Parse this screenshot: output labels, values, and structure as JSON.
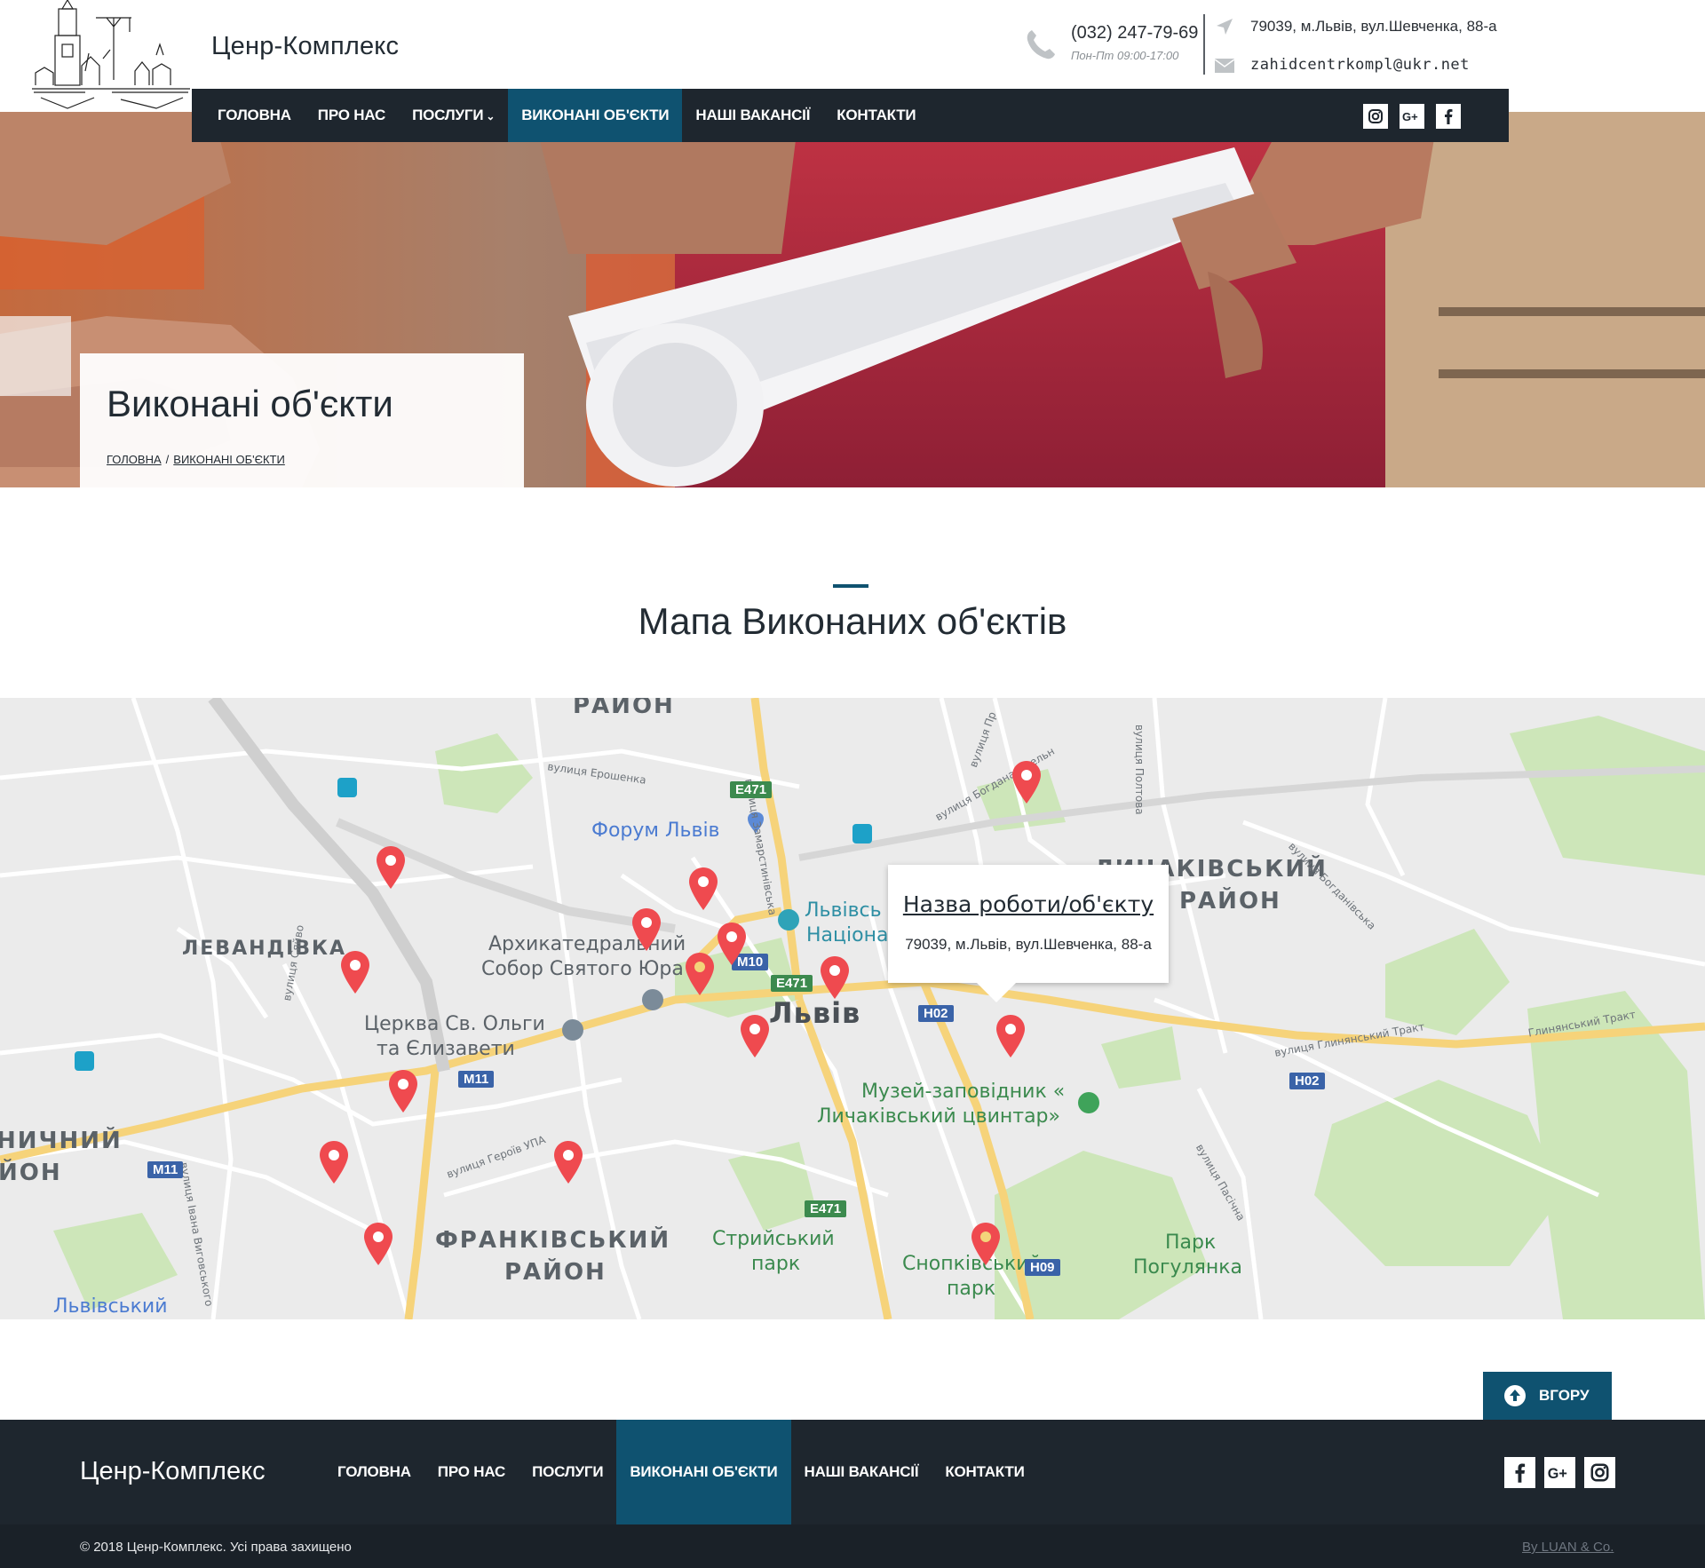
{
  "header": {
    "brand": "Ценр-Комплекс",
    "phone": "(032) 247-79-69",
    "hours": "Пон-Пт 09:00-17:00",
    "address": "79039, м.Львів, вул.Шевченка, 88-а",
    "email": "zahidcentrkompl@ukr.net"
  },
  "nav": {
    "items": [
      "ГОЛОВНА",
      "ПРО НАС",
      "ПОСЛУГИ",
      "ВИКОНАНІ ОБ'ЄКТИ",
      "НАШІ ВАКАНСІЇ",
      "КОНТАКТИ"
    ],
    "active": "ВИКОНАНІ ОБ'ЄКТИ",
    "social_icons": [
      "instagram-icon",
      "google-plus-icon",
      "facebook-icon"
    ]
  },
  "hero": {
    "title": "Виконані об'єкти",
    "breadcrumbs": [
      "ГОЛОВНА",
      "ВИКОНАНІ ОБ'ЄКТИ"
    ]
  },
  "section": {
    "title": "Мапа Виконаних об'єктів"
  },
  "map": {
    "districts": [
      "РАЙОН",
      "ЛЕВАНДІВКА",
      "ЛИЧАКІВСЬКИЙ",
      "РАЙОН",
      "ФРАНКІВСЬКИЙ",
      "РАЙОН",
      "НИЧНИЙ",
      "ЙОН",
      "Львів"
    ],
    "pois": [
      "Форум Львів",
      "Архикатедральний",
      "Собор Святого Юра",
      "Церква Св. Ольги",
      "та Єлизавети",
      "Львівсь",
      "Націона",
      "Музей-заповідник «",
      "Личаківський цвинтар»",
      "Стрийський",
      "парк",
      "Парк",
      "Погулянка",
      "Сноп­ківський",
      "парк",
      "Львівський"
    ],
    "streets": [
      "вулиця Ерошенка",
      "вулиця Замарстинівська",
      "вулиця Богдана Хмельн",
      "вулиця Пр",
      "вулиця Полтова",
      "вулиця Богданівська",
      "вулиця Сяйво",
      "вулиця Героїв УПА",
      "вулиця Івана Виговського",
      "вулиця Пасічна",
      "вулиця Глинянський Тракт",
      "Глинянський Тракт"
    ],
    "shields": [
      "E471",
      "M10",
      "E471",
      "H02",
      "M11",
      "M11",
      "H02",
      "E471",
      "H09"
    ],
    "pin_count": 17,
    "popup": {
      "title": "Назва роботи/об'єкту",
      "address": "79039, м.Львів, вул.Шевченка, 88-а"
    },
    "colors": {
      "pin": "#ef4a4f",
      "park": "#cde6b9",
      "road": "#ffffff",
      "highway": "#f6d37a"
    }
  },
  "totop": {
    "label": "ВГОРУ"
  },
  "footer": {
    "brand": "Ценр-Комплекс",
    "nav": [
      "ГОЛОВНА",
      "ПРО НАС",
      "ПОСЛУГИ",
      "ВИКОНАНІ ОБ'ЄКТИ",
      "НАШІ ВАКАНСІЇ",
      "КОНТАКТИ"
    ],
    "social_icons": [
      "facebook-icon",
      "google-plus-icon",
      "instagram-icon"
    ],
    "copyright": "© 2018 Ценр-Комплекс. Усі права захищено",
    "byline": "By LUAN & Co."
  },
  "colors": {
    "navbar": "#1e262e",
    "accent": "#0f5270",
    "text": "#222b33"
  }
}
